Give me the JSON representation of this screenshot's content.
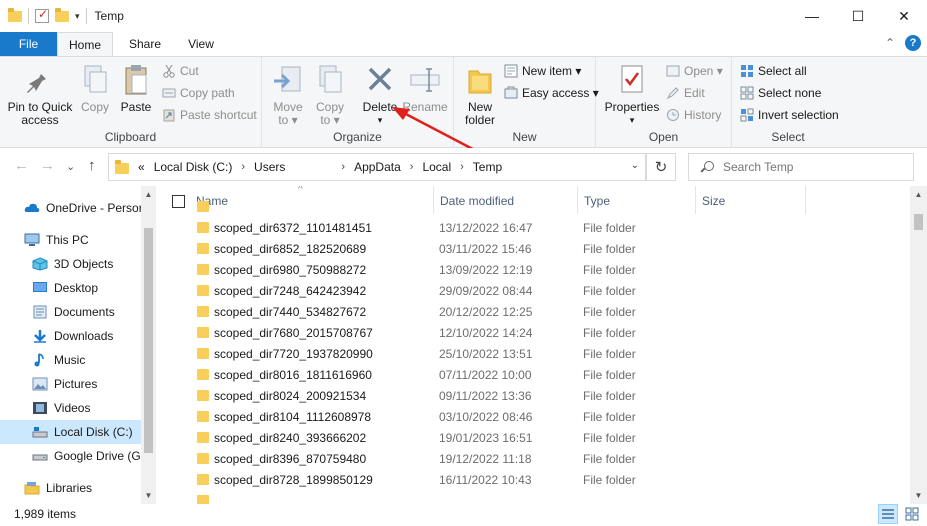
{
  "window": {
    "title": "Temp",
    "qa_dropdown": "▾",
    "controls": {
      "minimize": "—",
      "maximize": "☐",
      "close": "✕"
    }
  },
  "tabs": [
    {
      "label": "File"
    },
    {
      "label": "Home"
    },
    {
      "label": "Share"
    },
    {
      "label": "View"
    }
  ],
  "ribbon": {
    "clipboard": {
      "label": "Clipboard",
      "pin": "Pin to Quick access",
      "copy": "Copy",
      "paste": "Paste",
      "cut": "Cut",
      "copy_path": "Copy path",
      "paste_shortcut": "Paste shortcut"
    },
    "organize": {
      "label": "Organize",
      "move_to": "Move to ▾",
      "copy_to": "Copy to ▾",
      "delete": "Delete",
      "delete_drop": "▾",
      "rename": "Rename"
    },
    "new": {
      "label": "New",
      "new_folder": "New folder",
      "new_item": "New item ▾",
      "easy_access": "Easy access ▾"
    },
    "open": {
      "label": "Open",
      "properties": "Properties",
      "properties_drop": "▾",
      "open": "Open ▾",
      "edit": "Edit",
      "history": "History"
    },
    "select": {
      "label": "Select",
      "select_all": "Select all",
      "select_none": "Select none",
      "invert": "Invert selection"
    }
  },
  "address": {
    "overflow": "«",
    "crumbs": [
      "Local Disk (C:)",
      "Users",
      "AppData",
      "Local",
      "Temp"
    ],
    "separator": "›",
    "dropdown": "⌄",
    "refresh": "↻",
    "search_placeholder": "Search Temp"
  },
  "nav_buttons": {
    "back": "←",
    "forward": "→",
    "recent": "⌄",
    "up": "↑"
  },
  "nav_pane": [
    {
      "label": "OneDrive - Persor",
      "icon": "cloud-icon"
    },
    {
      "label": "This PC",
      "icon": "pc-icon"
    },
    {
      "label": "3D Objects",
      "icon": "cube-icon"
    },
    {
      "label": "Desktop",
      "icon": "desktop-icon"
    },
    {
      "label": "Documents",
      "icon": "documents-icon"
    },
    {
      "label": "Downloads",
      "icon": "download-icon"
    },
    {
      "label": "Music",
      "icon": "music-icon"
    },
    {
      "label": "Pictures",
      "icon": "pictures-icon"
    },
    {
      "label": "Videos",
      "icon": "videos-icon"
    },
    {
      "label": "Local Disk (C:)",
      "icon": "drive-icon",
      "selected": true
    },
    {
      "label": "Google Drive (G:",
      "icon": "drive-icon"
    },
    {
      "label": "Libraries",
      "icon": "libraries-icon"
    }
  ],
  "columns": {
    "name": "Name",
    "date": "Date modified",
    "type": "Type",
    "size": "Size",
    "sort_indicator": "^"
  },
  "files": [
    {
      "name": "scoped_dir6372_1101481451",
      "date": "13/12/2022 16:47",
      "type": "File folder"
    },
    {
      "name": "scoped_dir6852_182520689",
      "date": "03/11/2022 15:46",
      "type": "File folder"
    },
    {
      "name": "scoped_dir6980_750988272",
      "date": "13/09/2022 12:19",
      "type": "File folder"
    },
    {
      "name": "scoped_dir7248_642423942",
      "date": "29/09/2022 08:44",
      "type": "File folder"
    },
    {
      "name": "scoped_dir7440_534827672",
      "date": "20/12/2022 12:25",
      "type": "File folder"
    },
    {
      "name": "scoped_dir7680_2015708767",
      "date": "12/10/2022 14:24",
      "type": "File folder"
    },
    {
      "name": "scoped_dir7720_1937820990",
      "date": "25/10/2022 13:51",
      "type": "File folder"
    },
    {
      "name": "scoped_dir8016_1811616960",
      "date": "07/11/2022 10:00",
      "type": "File folder"
    },
    {
      "name": "scoped_dir8024_200921534",
      "date": "09/11/2022 13:36",
      "type": "File folder"
    },
    {
      "name": "scoped_dir8104_1112608978",
      "date": "03/10/2022 08:46",
      "type": "File folder"
    },
    {
      "name": "scoped_dir8240_393666202",
      "date": "19/01/2023 16:51",
      "type": "File folder"
    },
    {
      "name": "scoped_dir8396_870759480",
      "date": "19/12/2022 11:18",
      "type": "File folder"
    },
    {
      "name": "scoped_dir8728_1899850129",
      "date": "16/11/2022 10:43",
      "type": "File folder"
    }
  ],
  "status": {
    "item_count": "1,989 items"
  },
  "colors": {
    "accent": "#1979ca",
    "annotation": "#e0201b",
    "folder": "#f7cf5a",
    "selection": "#cce8ff"
  }
}
